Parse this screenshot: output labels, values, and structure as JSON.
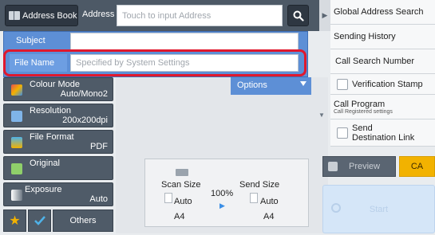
{
  "address_bar": {
    "address_book_label": "Address Book",
    "address_label": "Address",
    "address_placeholder": "Touch to input Address",
    "icons": {
      "book": "address-book-icon",
      "search": "search-icon"
    }
  },
  "right_menu": {
    "global_address_search": "Global Address Search",
    "sending_history": "Sending History",
    "call_search_number": "Call Search Number",
    "verification_stamp": "Verification Stamp",
    "call_program": "Call Program",
    "call_program_sub": "Call Registered settings",
    "send_destination_link_line1": "Send",
    "send_destination_link_line2": "Destination Link"
  },
  "fields": {
    "subject_label": "Subject",
    "subject_value": "",
    "filename_label": "File Name",
    "filename_placeholder": "Specified by System Settings",
    "highlight_color": "#e0182d"
  },
  "settings": [
    {
      "title": "Colour Mode",
      "value": "Auto/Mono2",
      "icon": "colour-mode-icon"
    },
    {
      "title": "Resolution",
      "value": "200x200dpi",
      "icon": "resolution-icon"
    },
    {
      "title": "File Format",
      "value": "PDF",
      "icon": "file-format-icon"
    },
    {
      "title": "Original",
      "value": "",
      "icon": "original-icon"
    },
    {
      "title": "Exposure",
      "value": "Auto",
      "icon": "exposure-icon"
    }
  ],
  "bottom_left": {
    "others_label": "Others",
    "icons": {
      "star": "star-icon",
      "check": "checkmark-icon"
    }
  },
  "options_label": "Options",
  "preview_panel": {
    "scan_size_label": "Scan Size",
    "scan_size_mode": "Auto",
    "scan_size_paper": "A4",
    "ratio": "100%",
    "send_size_label": "Send Size",
    "send_size_mode": "Auto",
    "send_size_paper": "A4"
  },
  "actions": {
    "preview_label": "Preview",
    "ca_label": "CA",
    "start_label": "Start"
  },
  "colors": {
    "accent_blue": "#5d8fd6",
    "dark_button": "#4f5b68",
    "ca_yellow": "#f2b200",
    "start_blue": "#d5e6f8"
  }
}
